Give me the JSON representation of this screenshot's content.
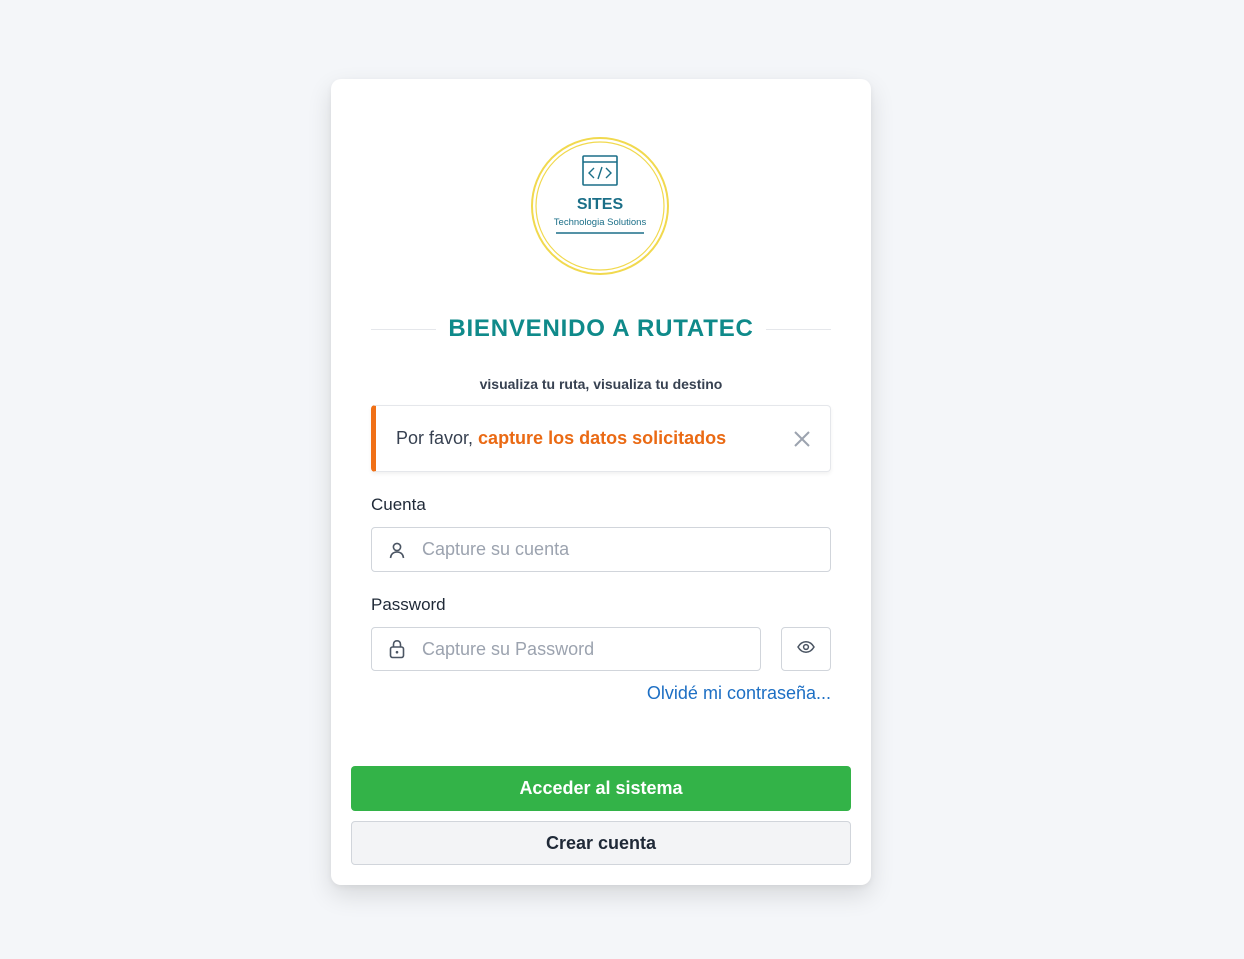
{
  "logo": {
    "name": "SITES",
    "tagline": "Technologia Solutions",
    "icon": "code-window-icon",
    "ring_color": "#f1d94e",
    "brand_color": "#1b6f88"
  },
  "header": {
    "title": "BIENVENIDO A RUTATEC",
    "subtitle": "visualiza tu ruta, visualiza tu destino"
  },
  "alert": {
    "prefix": "Por favor,",
    "message": "capture los datos solicitados",
    "accent_color": "#f07016"
  },
  "form": {
    "account_label": "Cuenta",
    "account_placeholder": "Capture su cuenta",
    "account_value": "",
    "password_label": "Password",
    "password_placeholder": "Capture su Password",
    "password_value": "",
    "forgot_link": "Olvidé mi contraseña..."
  },
  "actions": {
    "login_label": "Acceder al sistema",
    "login_color": "#33b348",
    "create_label": "Crear cuenta"
  }
}
